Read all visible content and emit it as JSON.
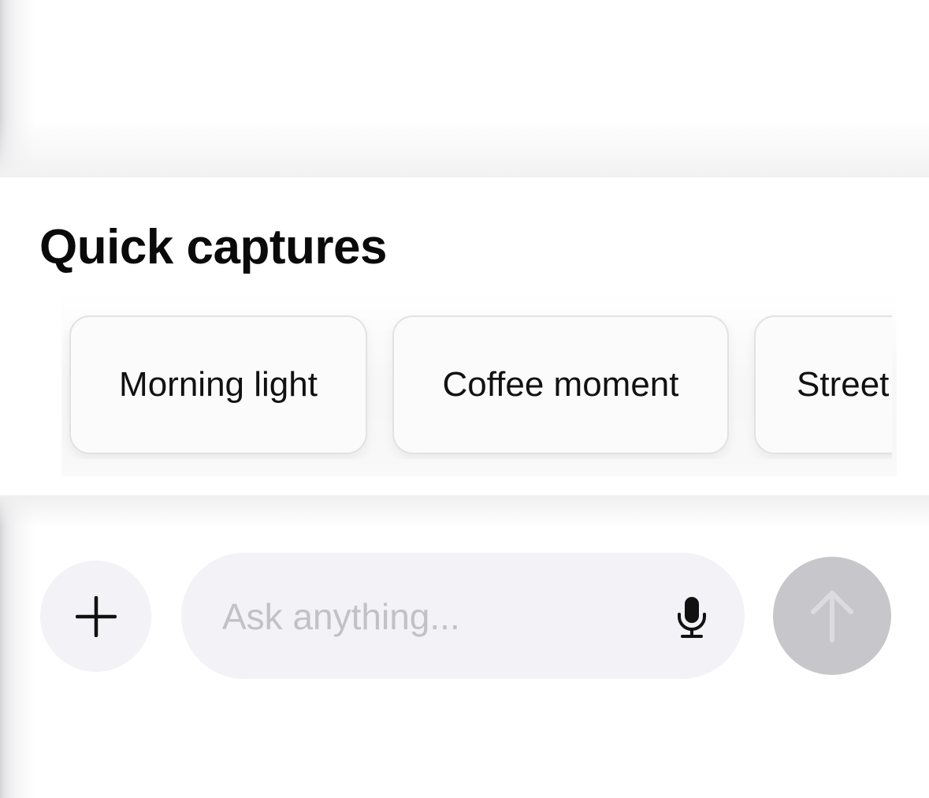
{
  "quick_captures": {
    "title": "Quick captures",
    "chips": [
      {
        "label": "Morning light"
      },
      {
        "label": "Coffee moment"
      },
      {
        "label": "Street"
      }
    ]
  },
  "composer": {
    "input_value": "",
    "placeholder": "Ask anything...",
    "icons": {
      "add": "plus-icon",
      "mic": "microphone-icon",
      "send": "arrow-up-icon"
    },
    "colors": {
      "pill_background": "#f2f2f7",
      "placeholder": "#c2c2c6",
      "send_disabled": "#c7c7cb"
    }
  }
}
